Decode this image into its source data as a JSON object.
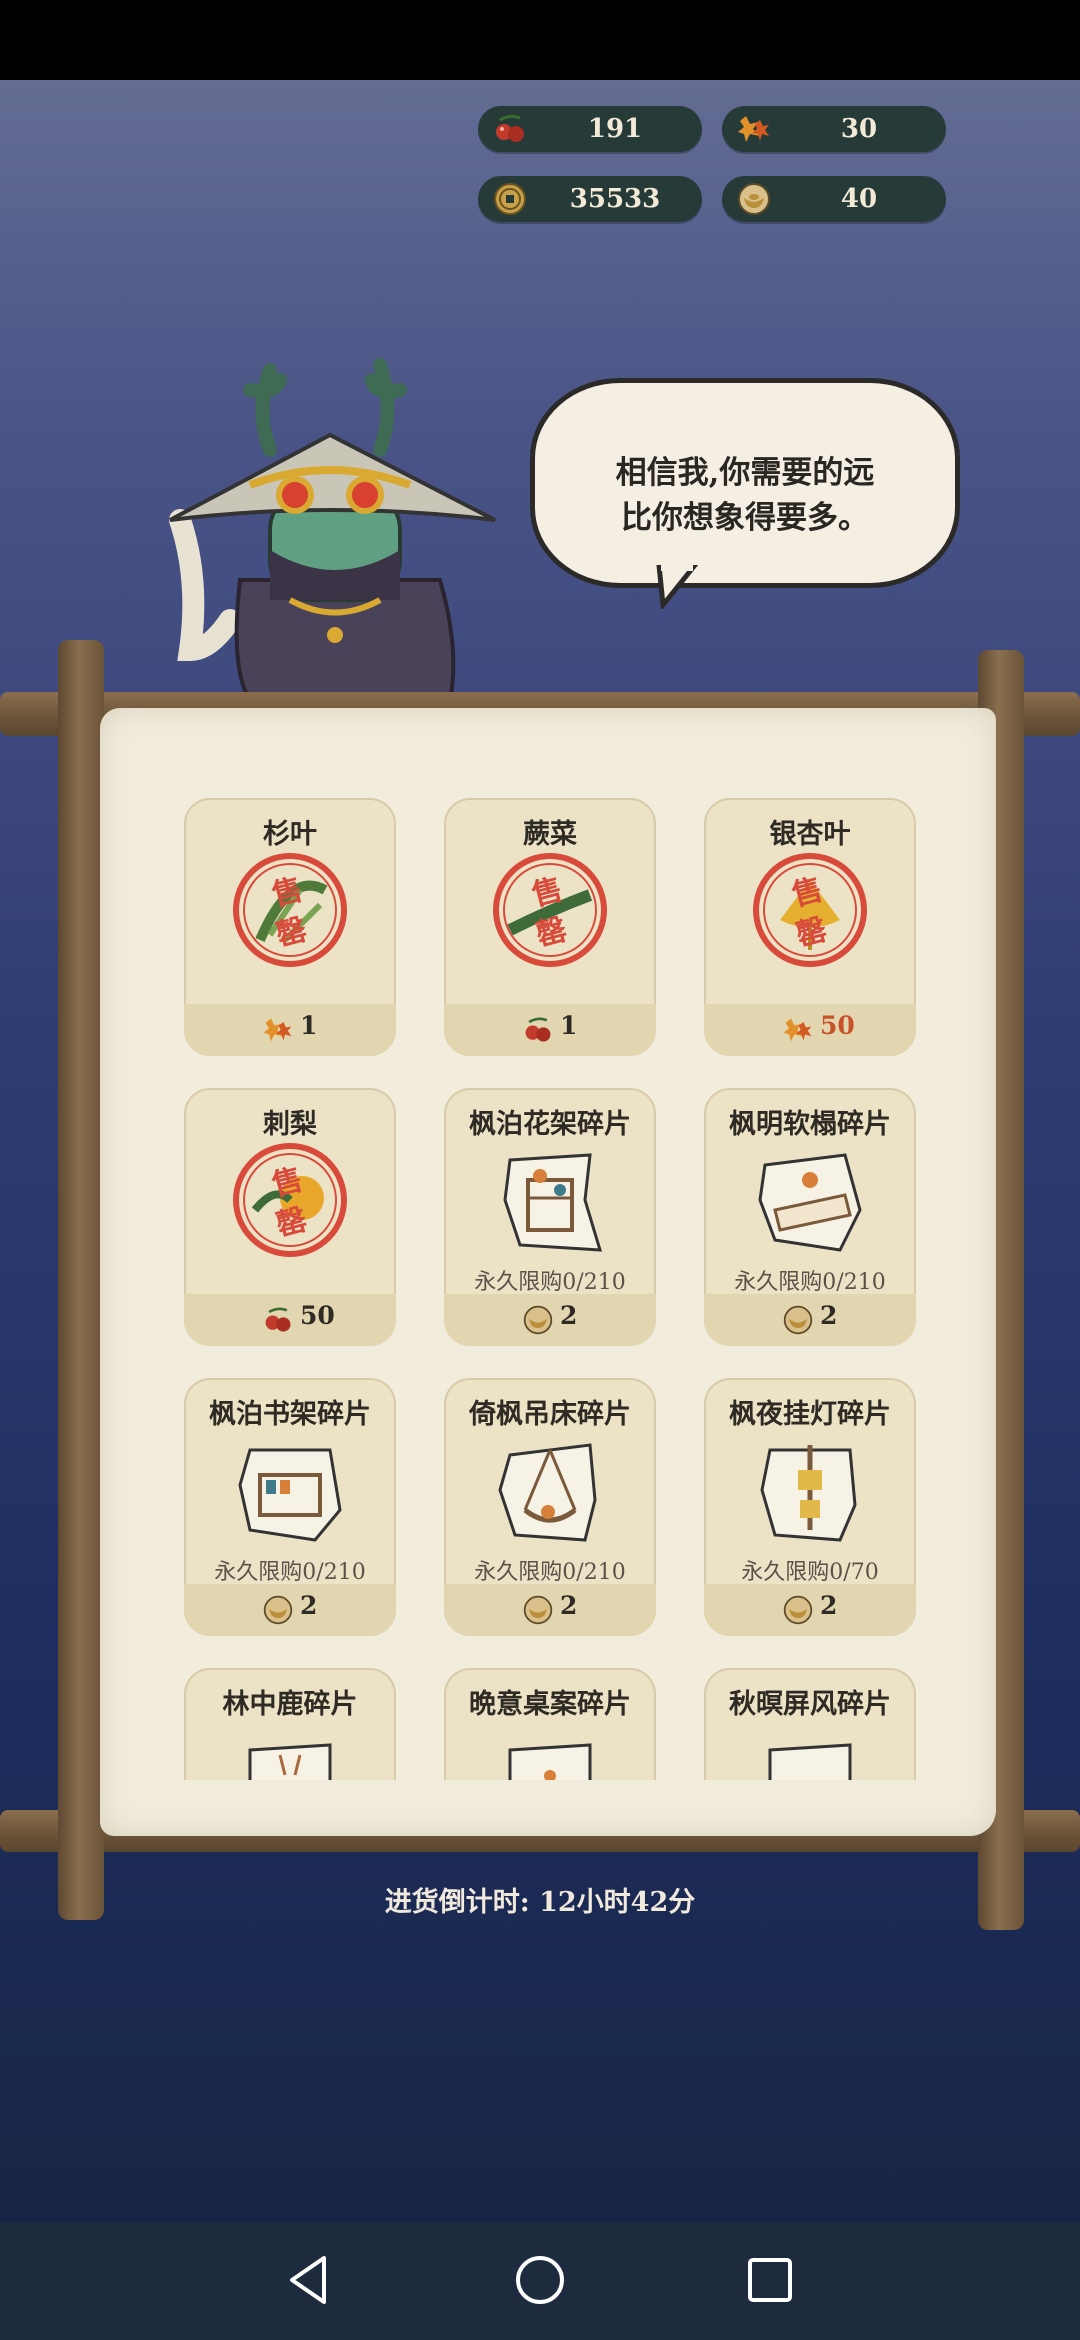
{
  "currencies": [
    {
      "icon": "berries-icon",
      "value": "191"
    },
    {
      "icon": "maple-leaves-icon",
      "value": "30"
    },
    {
      "icon": "copper-coin-icon",
      "value": "35533"
    },
    {
      "icon": "gold-ingot-icon",
      "value": "40"
    }
  ],
  "speech": {
    "line1": "相信我,你需要的远",
    "line2": "比你想象得要多。"
  },
  "shop_items": [
    {
      "name": "杉叶",
      "status": "售罄",
      "price_icon": "maple-leaves-icon",
      "price": "1"
    },
    {
      "name": "蕨菜",
      "status": "售罄",
      "price_icon": "berries-icon",
      "price": "1"
    },
    {
      "name": "银杏叶",
      "status": "售罄",
      "price_icon": "maple-leaves-icon",
      "price": "50"
    },
    {
      "name": "刺梨",
      "status": "售罄",
      "price_icon": "berries-icon",
      "price": "50"
    },
    {
      "name": "枫泊花架碎片",
      "limit": "永久限购0/210",
      "price_icon": "gold-ingot-icon",
      "price": "2"
    },
    {
      "name": "枫明软榻碎片",
      "limit": "永久限购0/210",
      "price_icon": "gold-ingot-icon",
      "price": "2"
    },
    {
      "name": "枫泊书架碎片",
      "limit": "永久限购0/210",
      "price_icon": "gold-ingot-icon",
      "price": "2"
    },
    {
      "name": "倚枫吊床碎片",
      "limit": "永久限购0/210",
      "price_icon": "gold-ingot-icon",
      "price": "2"
    },
    {
      "name": "枫夜挂灯碎片",
      "limit": "永久限购0/70",
      "price_icon": "gold-ingot-icon",
      "price": "2"
    },
    {
      "name": "林中鹿碎片"
    },
    {
      "name": "晩意桌案碎片"
    },
    {
      "name": "秋暝屏风碎片"
    }
  ],
  "restock_timer": "进货倒计时: 12小时42分",
  "colors": {
    "price_red": "#c8522a",
    "sold_out_stamp": "#d84a3a",
    "pill_bg": "#263a38"
  }
}
